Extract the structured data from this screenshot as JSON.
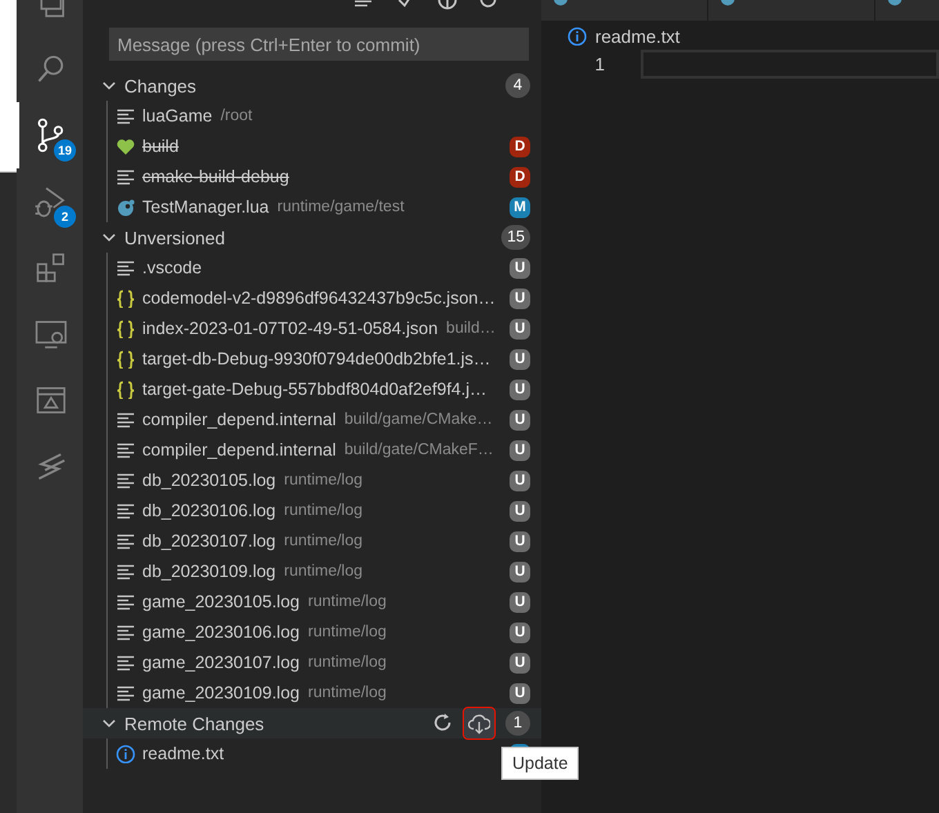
{
  "activity_bar": [
    {
      "kind": "files",
      "selected": false
    },
    {
      "kind": "search",
      "selected": false
    },
    {
      "kind": "source-control",
      "selected": true,
      "badge": "19"
    },
    {
      "kind": "run-debug",
      "selected": false,
      "badge": "2"
    },
    {
      "kind": "extensions",
      "selected": false
    },
    {
      "kind": "remote",
      "selected": false
    },
    {
      "kind": "panel",
      "selected": false
    },
    {
      "kind": "s-logo",
      "selected": false
    }
  ],
  "sidebar": {
    "header_actions": [
      {
        "kind": "lines"
      },
      {
        "kind": "check"
      },
      {
        "kind": "circle"
      },
      {
        "kind": "refresh"
      }
    ],
    "commit_message": {
      "placeholder": "Message (press Ctrl+Enter to commit)"
    },
    "groups": [
      {
        "label": "Changes",
        "count": "4",
        "expanded": true,
        "items": [
          {
            "kind": "lines",
            "name": "luaGame",
            "path": "/root",
            "deleted": false
          },
          {
            "kind": "heart",
            "name": "build",
            "deleted": true,
            "badge": {
              "letter": "D",
              "color": "#a1260d"
            }
          },
          {
            "kind": "lines",
            "name": "cmake-build-debug",
            "deleted": true,
            "badge": {
              "letter": "D",
              "color": "#a1260d"
            }
          },
          {
            "kind": "lua",
            "name": "TestManager.lua",
            "path": "runtime/game/test",
            "deleted": false,
            "badge": {
              "letter": "M",
              "color": "#1b80b2"
            }
          }
        ]
      },
      {
        "label": "Unversioned",
        "count": "15",
        "expanded": true,
        "items": [
          {
            "kind": "lines",
            "name": ".vscode",
            "deleted": false,
            "badge": {
              "letter": "U",
              "color": "#6c6c6c"
            }
          },
          {
            "kind": "json",
            "name": "codemodel-v2-d9896df96432437b9c5c.json…",
            "deleted": false,
            "badge": {
              "letter": "U",
              "color": "#6c6c6c"
            }
          },
          {
            "kind": "json",
            "name": "index-2023-01-07T02-49-51-0584.json",
            "path": "build…",
            "deleted": false,
            "badge": {
              "letter": "U",
              "color": "#6c6c6c"
            }
          },
          {
            "kind": "json",
            "name": "target-db-Debug-9930f0794de00db2bfe1.js…",
            "deleted": false,
            "badge": {
              "letter": "U",
              "color": "#6c6c6c"
            }
          },
          {
            "kind": "json",
            "name": "target-gate-Debug-557bbdf804d0af2ef9f4.j…",
            "deleted": false,
            "badge": {
              "letter": "U",
              "color": "#6c6c6c"
            }
          },
          {
            "kind": "lines",
            "name": "compiler_depend.internal",
            "path": "build/game/CMake…",
            "deleted": false,
            "badge": {
              "letter": "U",
              "color": "#6c6c6c"
            }
          },
          {
            "kind": "lines",
            "name": "compiler_depend.internal",
            "path": "build/gate/CMakeF…",
            "deleted": false,
            "badge": {
              "letter": "U",
              "color": "#6c6c6c"
            }
          },
          {
            "kind": "lines",
            "name": "db_20230105.log",
            "path": "runtime/log",
            "deleted": false,
            "badge": {
              "letter": "U",
              "color": "#6c6c6c"
            }
          },
          {
            "kind": "lines",
            "name": "db_20230106.log",
            "path": "runtime/log",
            "deleted": false,
            "badge": {
              "letter": "U",
              "color": "#6c6c6c"
            }
          },
          {
            "kind": "lines",
            "name": "db_20230107.log",
            "path": "runtime/log",
            "deleted": false,
            "badge": {
              "letter": "U",
              "color": "#6c6c6c"
            }
          },
          {
            "kind": "lines",
            "name": "db_20230109.log",
            "path": "runtime/log",
            "deleted": false,
            "badge": {
              "letter": "U",
              "color": "#6c6c6c"
            }
          },
          {
            "kind": "lines",
            "name": "game_20230105.log",
            "path": "runtime/log",
            "deleted": false,
            "badge": {
              "letter": "U",
              "color": "#6c6c6c"
            }
          },
          {
            "kind": "lines",
            "name": "game_20230106.log",
            "path": "runtime/log",
            "deleted": false,
            "badge": {
              "letter": "U",
              "color": "#6c6c6c"
            }
          },
          {
            "kind": "lines",
            "name": "game_20230107.log",
            "path": "runtime/log",
            "deleted": false,
            "badge": {
              "letter": "U",
              "color": "#6c6c6c"
            }
          },
          {
            "kind": "lines",
            "name": "game_20230109.log",
            "path": "runtime/log",
            "deleted": false,
            "badge": {
              "letter": "U",
              "color": "#6c6c6c"
            }
          }
        ]
      },
      {
        "label": "Remote Changes",
        "count": "1",
        "expanded": true,
        "actions": [
          {
            "kind": "refresh",
            "highlighted": false
          },
          {
            "kind": "cloud-download",
            "highlighted": true
          }
        ],
        "items": [
          {
            "kind": "info",
            "name": "readme.txt",
            "deleted": false,
            "badge": {
              "color": "#1b80b2"
            }
          }
        ]
      }
    ],
    "tooltip": {
      "text": "Update"
    }
  },
  "editor": {
    "tabs": [
      {
        "kind": "lua"
      },
      {
        "kind": "lua"
      },
      {
        "kind": "lua"
      }
    ],
    "breadcrumb": {
      "kind": "info",
      "text": "readme.txt"
    },
    "lines": [
      {
        "number": "1",
        "current": true
      }
    ]
  }
}
